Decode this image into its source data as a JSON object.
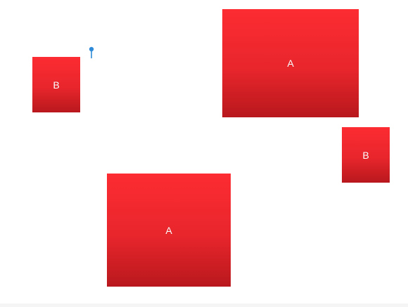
{
  "colors": {
    "background": "#ffffff",
    "box_top": "#fc2c32",
    "box_bottom": "#b8181d",
    "pin": "#2f8ad8",
    "label": "#ffffff"
  },
  "boxes": [
    {
      "label": "A"
    },
    {
      "label": "B"
    },
    {
      "label": "B"
    },
    {
      "label": "A"
    }
  ],
  "pin": {
    "icon": "map-pin-icon"
  }
}
